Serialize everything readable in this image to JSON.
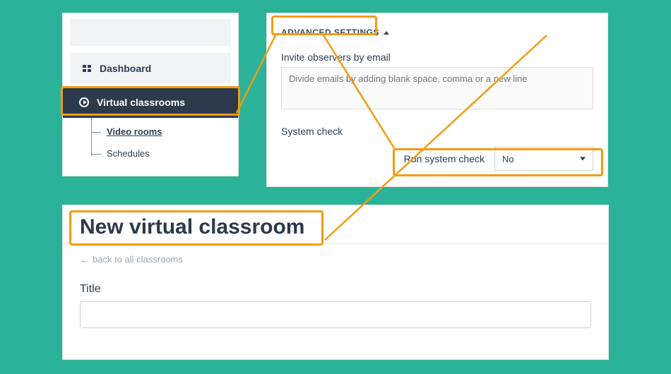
{
  "sidebar": {
    "items": [
      {
        "label": "Dashboard"
      },
      {
        "label": "Virtual classrooms"
      }
    ],
    "sub_items": [
      {
        "label": "Video rooms"
      },
      {
        "label": "Schedules"
      }
    ]
  },
  "settings": {
    "advanced_label": "ADVANCED SETTINGS",
    "invite_label": "Invite observers by email",
    "invite_placeholder": "Divide emails by adding blank space, comma or a new line",
    "system_check_heading": "System check",
    "run_system_check_label": "Run system check",
    "run_system_check_value": "No"
  },
  "main": {
    "page_title": "New virtual classroom",
    "back_label": "back to all classrooms",
    "title_field_label": "Title"
  }
}
